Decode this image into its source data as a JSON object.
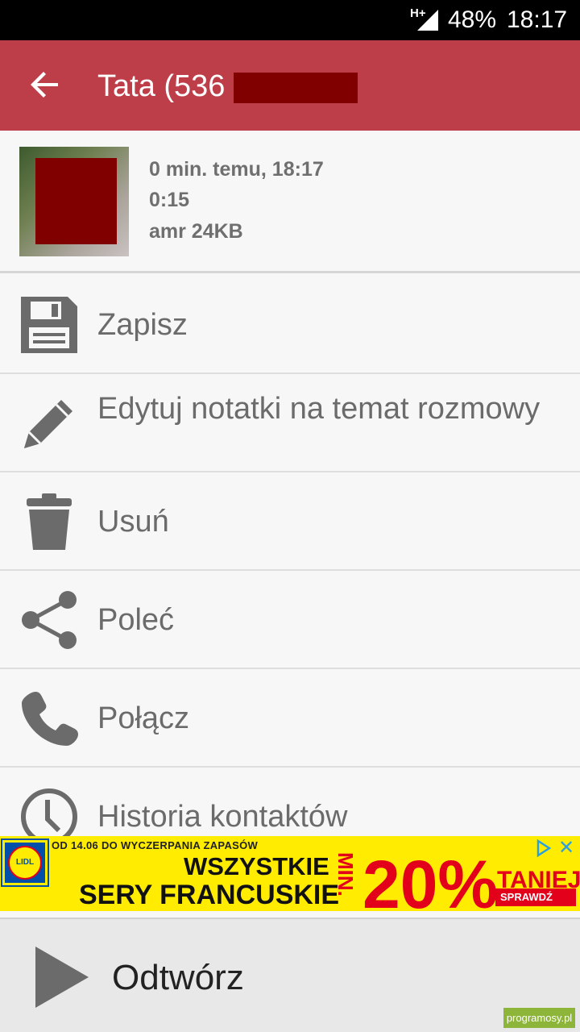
{
  "status_bar": {
    "network": "H+",
    "battery": "48%",
    "time": "18:17"
  },
  "app_bar": {
    "title": "Tata (536",
    "back_icon": "arrow-left-icon"
  },
  "recording": {
    "when": "0 min. temu, 18:17",
    "duration": "0:15",
    "format_size": "amr 24KB"
  },
  "menu": [
    {
      "icon": "save-icon",
      "label": "Zapisz"
    },
    {
      "icon": "pencil-icon",
      "label": "Edytuj notatki na temat rozmowy"
    },
    {
      "icon": "trash-icon",
      "label": "Usuń"
    },
    {
      "icon": "share-icon",
      "label": "Poleć"
    },
    {
      "icon": "phone-icon",
      "label": "Połącz"
    },
    {
      "icon": "clock-icon",
      "label": "Historia kontaktów"
    }
  ],
  "ad": {
    "logo": "LIDL",
    "top_line": "OD 14.06 DO WYCZERPANIA ZAPASÓW",
    "line1": "WSZYSTKIE",
    "line2": "SERY FRANCUSKIE",
    "min": "MIN.",
    "discount": "20%",
    "cheaper": "TANIEJ",
    "cta": "SPRAWDŹ",
    "close": "✕"
  },
  "player": {
    "label": "Odtwórz",
    "icon": "play-icon"
  },
  "watermark": "programosy.pl",
  "colors": {
    "app_bar": "#bd3e48",
    "redaction": "#800000",
    "icon_gray": "#6b6b6b",
    "ad_bg": "#ffec00",
    "ad_red": "#e2001a"
  }
}
